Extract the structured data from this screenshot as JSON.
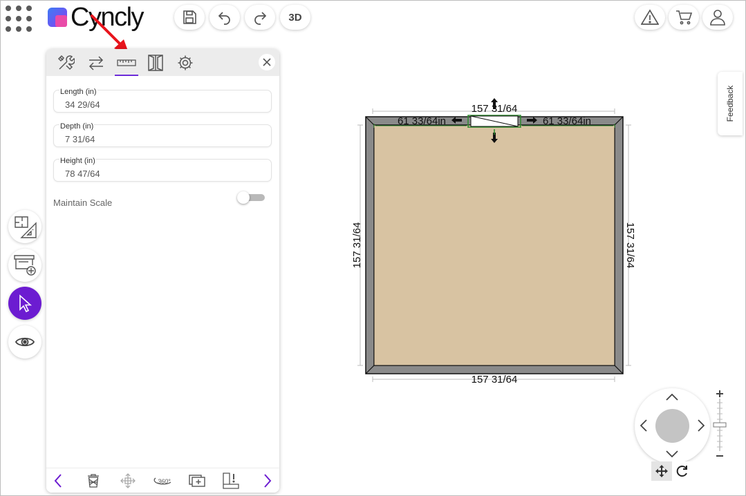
{
  "app": {
    "logo_text": "Cyncly"
  },
  "toolbar": {
    "apps_icon": "apps-grid-icon",
    "save_icon": "save-icon",
    "undo_icon": "undo-icon",
    "redo_icon": "redo-icon",
    "btn_3d_label": "3D",
    "warning_icon": "warning-icon",
    "cart_icon": "cart-icon",
    "user_icon": "user-icon"
  },
  "panel": {
    "tabs": [
      {
        "icon": "tools-icon",
        "active": false
      },
      {
        "icon": "swap-icon",
        "active": false
      },
      {
        "icon": "ruler-icon",
        "active": true
      },
      {
        "icon": "door-icon",
        "active": false
      },
      {
        "icon": "gear-icon",
        "active": false
      }
    ],
    "fields": {
      "length": {
        "label": "Length (in)",
        "value": "34 29/64"
      },
      "depth": {
        "label": "Depth (in)",
        "value": "7 31/64"
      },
      "height": {
        "label": "Height (in)",
        "value": "78 47/64"
      }
    },
    "maintain_scale": {
      "label": "Maintain Scale",
      "on": false
    },
    "footer": [
      "chevron-left-icon",
      "trash-icon",
      "move-icon",
      "360-view-icon",
      "duplicate-icon",
      "alignment-icon",
      "chevron-right-icon"
    ]
  },
  "rail": [
    "floorplan-icon",
    "add-cabinet-icon",
    "select-cursor-icon",
    "eye-icon"
  ],
  "feedback": {
    "label": "Feedback"
  },
  "plan": {
    "room_width_top": "157 31/64",
    "room_width_bottom": "157 31/64",
    "room_height_left": "157 31/64",
    "room_height_right": "157 31/64",
    "gap_left": "61 33/64in",
    "gap_right": "61 33/64in",
    "floor_color": "#d8c3a2",
    "wall_color": "#8a8a8a"
  },
  "colors": {
    "accent": "#6c1cd1",
    "annotation": "#e8141c"
  }
}
